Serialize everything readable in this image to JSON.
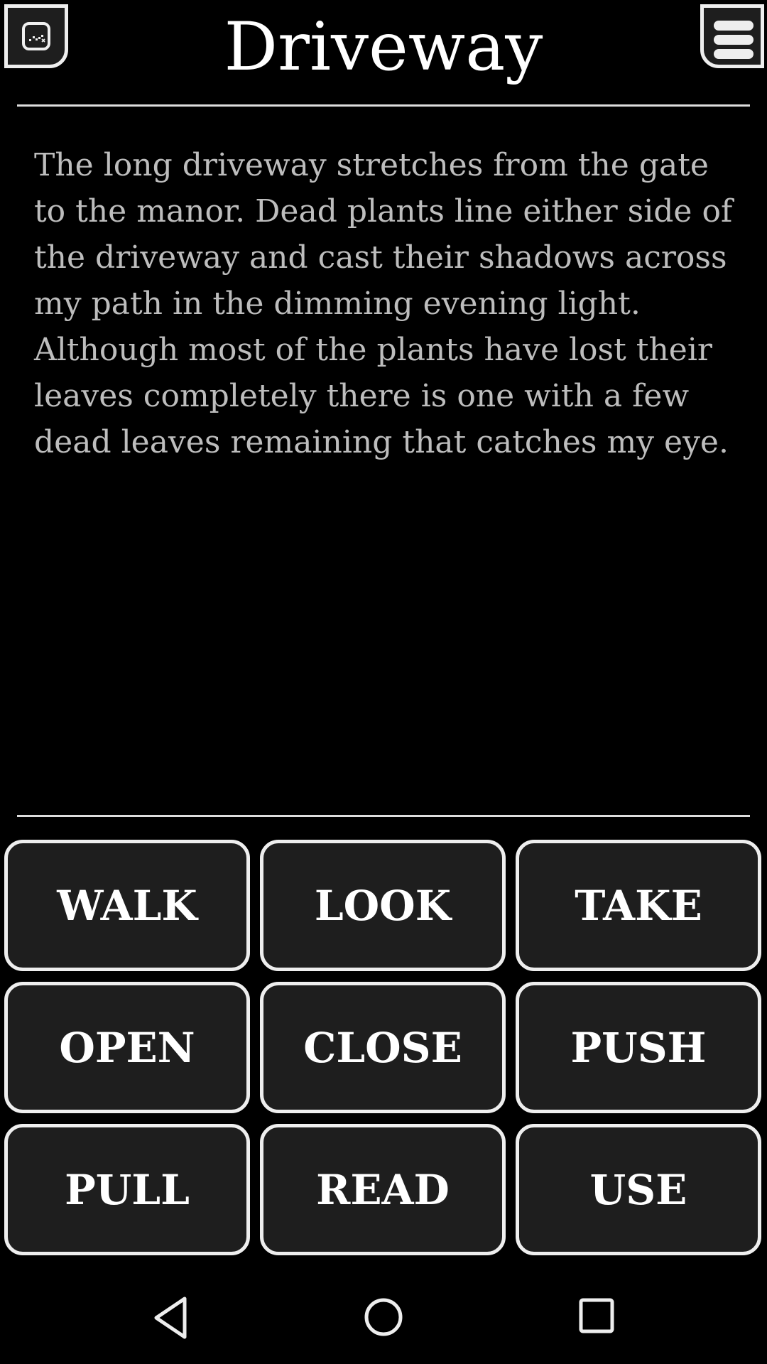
{
  "header": {
    "title": "Driveway",
    "map_button_icon": "map-icon",
    "menu_button_icon": "hamburger-menu-icon"
  },
  "room": {
    "description": "The long driveway stretches from the gate to the manor. Dead plants line either side of the driveway and cast their shadows across my path in the dimming evening light. Although most of the plants have lost their leaves completely there is one with a few dead leaves remaining that catches my eye."
  },
  "verbs": [
    {
      "label": "WALK"
    },
    {
      "label": "LOOK"
    },
    {
      "label": "TAKE"
    },
    {
      "label": "OPEN"
    },
    {
      "label": "CLOSE"
    },
    {
      "label": "PUSH"
    },
    {
      "label": "PULL"
    },
    {
      "label": "READ"
    },
    {
      "label": "USE"
    }
  ],
  "navbar": {
    "back_icon": "back-triangle-icon",
    "home_icon": "home-circle-icon",
    "recents_icon": "recents-square-icon"
  }
}
